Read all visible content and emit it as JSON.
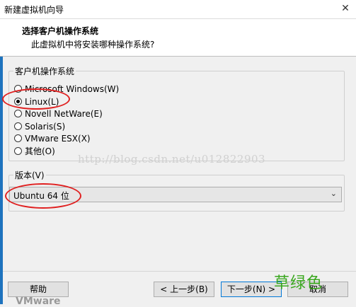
{
  "window": {
    "title": "新建虚拟机向导",
    "close_glyph": "✕"
  },
  "header": {
    "heading": "选择客户机操作系统",
    "subheading": "此虚拟机中将安装哪种操作系统?"
  },
  "guest_os": {
    "legend": "客户机操作系统",
    "options": [
      {
        "label": "Microsoft Windows(W)",
        "checked": false
      },
      {
        "label": "Linux(L)",
        "checked": true
      },
      {
        "label": "Novell NetWare(E)",
        "checked": false
      },
      {
        "label": "Solaris(S)",
        "checked": false
      },
      {
        "label": "VMware ESX(X)",
        "checked": false
      },
      {
        "label": "其他(O)",
        "checked": false
      }
    ]
  },
  "version": {
    "legend": "版本(V)",
    "selected": "Ubuntu 64 位",
    "chevron_icon": "chevron-down-icon"
  },
  "watermark": "http://blog.csdn.net/u012822903",
  "buttons": {
    "help": "帮助",
    "back": "< 上一步(B)",
    "next": "下一步(N) >",
    "cancel": "取消"
  },
  "stamp": "草绿色",
  "bottom_fragment": "VMware",
  "colors": {
    "annotation_red": "#e02020",
    "stamp_green": "#3aa71f",
    "accent_blue": "#1e73be"
  }
}
